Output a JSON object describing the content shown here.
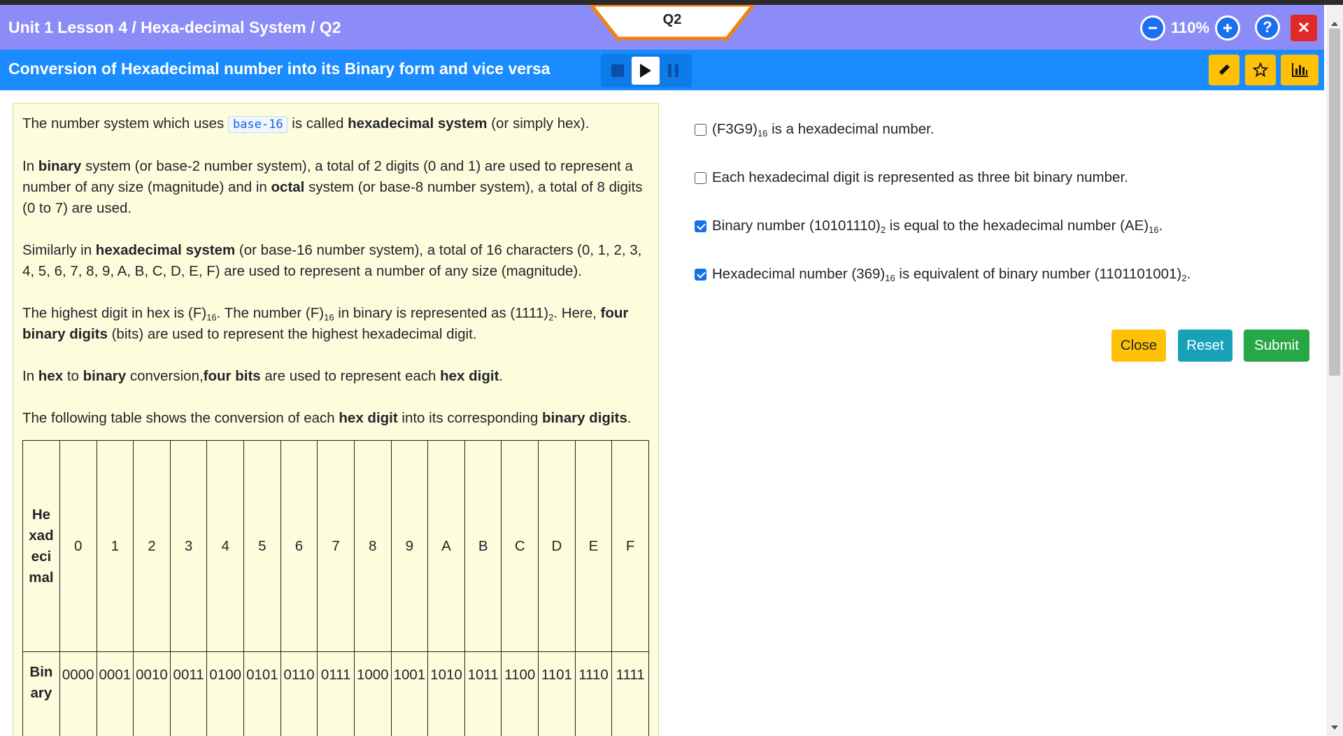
{
  "header": {
    "breadcrumb": "Unit 1 Lesson 4 / Hexa-decimal System / Q2",
    "question_tab": "Q2",
    "zoom": "110%",
    "icons": {
      "zoom_out": "minus-circle-icon",
      "zoom_in": "plus-circle-icon",
      "help": "question-icon",
      "close": "close-icon"
    },
    "colors": {
      "header_bg": "#8c8cf8",
      "tab_border": "#f0820f",
      "close_bg": "#e02a2a"
    }
  },
  "subheader": {
    "title": "Conversion of Hexadecimal number into its Binary form and vice versa",
    "media_icons": [
      "stop-icon",
      "play-icon",
      "pause-icon"
    ],
    "tool_icons": [
      "pencil-icon",
      "star-icon",
      "bar-chart-icon"
    ],
    "colors": {
      "subheader_bg": "#1a8cff",
      "tool_bg": "#ffc107"
    }
  },
  "content": {
    "p1": {
      "a": "The number system which uses ",
      "code": "base-16",
      "b": " is called ",
      "bold": "hexadecimal system",
      "c": " (or simply hex)."
    },
    "p2": {
      "a": "In ",
      "b1": "binary",
      "b": " system (or base-2 number system), a total of 2 digits (0 and 1) are used to represent a number of any size (magnitude) and in ",
      "b2": "octal",
      "c": " system (or base-8 number system), a total of 8 digits (0 to 7) are used."
    },
    "p3": {
      "a": "Similarly in ",
      "b1": "hexadecimal system",
      "b": " (or base-16 number system), a total of 16 characters (0, 1, 2, 3, 4, 5, 6, 7, 8, 9, A, B, C, D, E, F) are used to represent a number of any size (magnitude)."
    },
    "p4": {
      "a": "The highest digit in hex is (F)",
      "s1": "16",
      "b": ". The number (F)",
      "s2": "16",
      "c": " in binary is represented as (1111)",
      "s3": "2",
      "d": ". Here, ",
      "b1": "four binary digits",
      "e": " (bits) are used to represent the highest hexadecimal digit."
    },
    "p5": {
      "a": "In ",
      "b1": "hex",
      "b": " to ",
      "b2": "binary",
      "c": " conversion,",
      "b3": "four bits",
      "d": " are used to represent each ",
      "b4": "hex digit",
      "e": "."
    },
    "p6": {
      "a": "The following table shows the conversion of each ",
      "b1": "hex digit",
      "b": " into its corresponding ",
      "b2": "binary digits",
      "c": "."
    },
    "table": {
      "row1_header": "Hexadecimal",
      "row2_header": "Binary",
      "hex": [
        "0",
        "1",
        "2",
        "3",
        "4",
        "5",
        "6",
        "7",
        "8",
        "9",
        "A",
        "B",
        "C",
        "D",
        "E",
        "F"
      ],
      "binary": [
        "0000",
        "0001",
        "0010",
        "0011",
        "0100",
        "0101",
        "0110",
        "0111",
        "1000",
        "1001",
        "1010",
        "1011",
        "1100",
        "1101",
        "1110",
        "1111"
      ]
    }
  },
  "questions": [
    {
      "checked": false,
      "a": "(F3G9)",
      "s1": "16",
      "b": " is a hexadecimal number."
    },
    {
      "checked": false,
      "a": "Each hexadecimal digit is represented as three bit binary number."
    },
    {
      "checked": true,
      "a": "Binary number (10101110)",
      "s1": "2",
      "b": " is equal to the hexadecimal number (AE)",
      "s2": "16",
      "c": "."
    },
    {
      "checked": true,
      "a": "Hexadecimal number (369)",
      "s1": "16",
      "b": " is equivalent of binary number (1101101001)",
      "s2": "2",
      "c": "."
    }
  ],
  "buttons": {
    "close": "Close",
    "reset": "Reset",
    "submit": "Submit"
  }
}
